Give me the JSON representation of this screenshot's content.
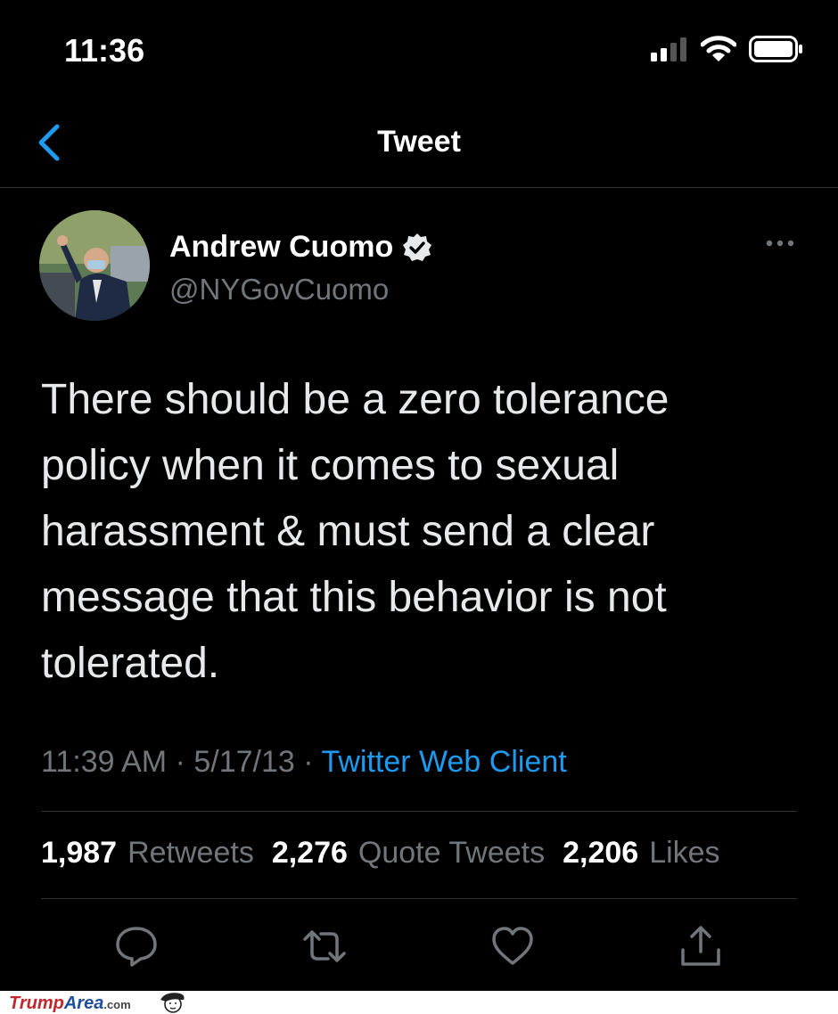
{
  "status_bar": {
    "time": "11:36"
  },
  "nav": {
    "title": "Tweet"
  },
  "tweet": {
    "display_name": "Andrew Cuomo",
    "handle": "@NYGovCuomo",
    "verified": true,
    "text": "There should be a zero tolerance\npolicy when it comes to sexual\nharassment & must send a clear\nmessage that this behavior is not\ntolerated.",
    "time": "11:39 AM",
    "date": "5/17/13",
    "separator": "·",
    "source": "Twitter Web Client"
  },
  "stats": {
    "retweets_count": "1,987",
    "retweets_label": "Retweets",
    "quotes_count": "2,276",
    "quotes_label": "Quote Tweets",
    "likes_count": "2,206",
    "likes_label": "Likes"
  },
  "watermark": {
    "part1": "Trump",
    "part2": "Area",
    "part3": ".com"
  },
  "colors": {
    "accent": "#1d9bf0",
    "background": "#000000",
    "secondary_text": "#71767b"
  }
}
